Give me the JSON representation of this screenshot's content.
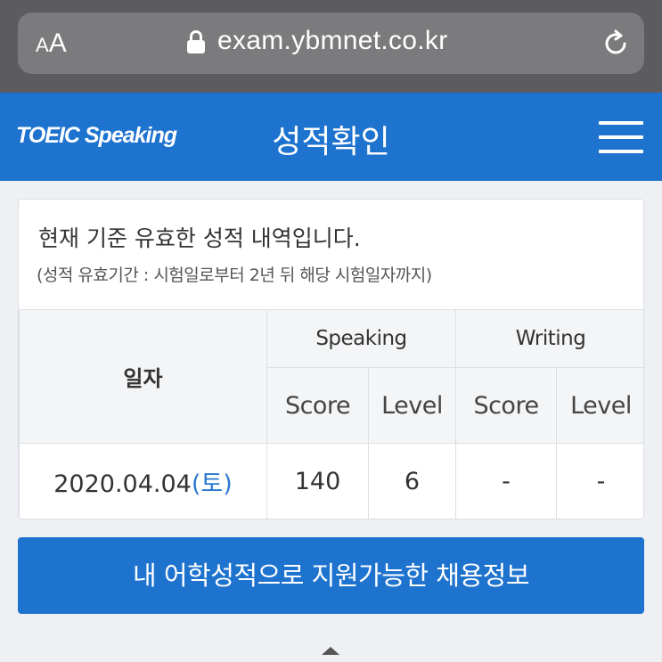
{
  "browser": {
    "text_size_small": "A",
    "text_size_big": "A",
    "url": "exam.ybmnet.co.kr"
  },
  "header": {
    "logo": "TOEIC Speaking",
    "title": "성적확인"
  },
  "card": {
    "title": "현재 기준 유효한 성적 내역입니다.",
    "subtitle": "(성적 유효기간 : 시험일로부터 2년 뒤 해당 시험일자까지)"
  },
  "table": {
    "date_header": "일자",
    "speaking_header": "Speaking",
    "writing_header": "Writing",
    "score_label": "Score",
    "level_label": "Level",
    "rows": [
      {
        "date": "2020.04.04",
        "day_of_week": "(토)",
        "speaking_score": "140",
        "speaking_level": "6",
        "writing_score": "-",
        "writing_level": "-"
      }
    ]
  },
  "jobs_button": "내 어학성적으로 지원가능한 채용정보",
  "colors": {
    "brand_blue": "#1e73cf",
    "browser_bar": "#5c5c5e",
    "page_bg": "#eef0f3",
    "day_of_week": "#2a78d0"
  },
  "icons": [
    "text-size-icon",
    "lock-icon",
    "reload-icon",
    "hamburger-menu-icon",
    "scroll-top-arrow-icon"
  ]
}
